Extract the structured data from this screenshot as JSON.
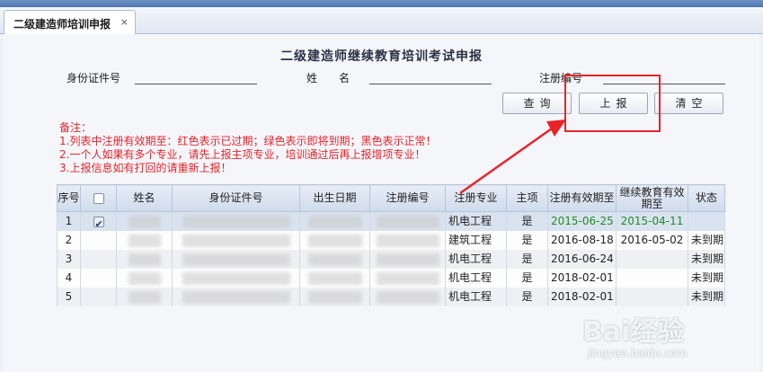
{
  "tab": {
    "label": "二级建造师培训申报",
    "close": "×"
  },
  "title": "二级建造师继续教育培训考试申报",
  "form": {
    "id_label": "身份证件号",
    "name_label": "姓　　名",
    "reg_label": "注册编号",
    "id_value": "",
    "name_value": "",
    "reg_value": ""
  },
  "buttons": {
    "query": "查询",
    "submit": "上报",
    "clear": "清空"
  },
  "notes": [
    "备注：",
    "1.列表中注册有效期至：红色表示已过期；绿色表示即将到期；黑色表示正常！",
    "2.一个人如果有多个专业，请先上报主项专业，培训通过后再上报增项专业！",
    "3.上报信息如有打回的请重新上报！"
  ],
  "table": {
    "headers": [
      "序号",
      "",
      "姓名",
      "身份证件号",
      "出生日期",
      "注册编号",
      "注册专业",
      "主项",
      "注册有效期至",
      "继续教育有效期至",
      "状态"
    ],
    "rows": [
      {
        "no": "1",
        "checked": true,
        "major": "机电工程",
        "main": "是",
        "reg_until": "2015-06-25",
        "edu_until": "2015-04-11",
        "status": "",
        "color": "#1f8b1f"
      },
      {
        "no": "2",
        "checked": false,
        "major": "建筑工程",
        "main": "是",
        "reg_until": "2016-08-18",
        "edu_until": "2016-05-02",
        "status": "未到期",
        "color": "#222222"
      },
      {
        "no": "3",
        "checked": false,
        "major": "机电工程",
        "main": "是",
        "reg_until": "2016-06-24",
        "edu_until": "",
        "status": "未到期",
        "color": "#222222"
      },
      {
        "no": "4",
        "checked": false,
        "major": "机电工程",
        "main": "是",
        "reg_until": "2018-02-01",
        "edu_until": "",
        "status": "未到期",
        "color": "#222222"
      },
      {
        "no": "5",
        "checked": false,
        "major": "机电工程",
        "main": "是",
        "reg_until": "2018-02-01",
        "edu_until": "",
        "status": "未到期",
        "color": "#222222"
      }
    ]
  },
  "annotation": {
    "color": "#e8232a"
  },
  "watermark": {
    "logo": "Bai经验",
    "sub": "jingyan.baidu.com"
  }
}
